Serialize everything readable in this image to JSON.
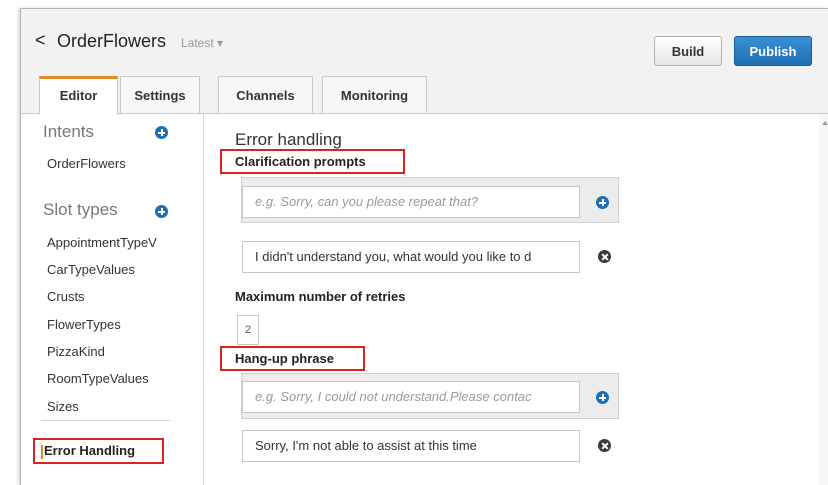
{
  "header": {
    "back_glyph": "<",
    "bot_name": "OrderFlowers",
    "version_label": "Latest ▾",
    "build_label": "Build",
    "publish_label": "Publish"
  },
  "tabs": [
    {
      "label": "Editor",
      "active": true
    },
    {
      "label": "Settings",
      "active": false
    },
    {
      "label": "Channels",
      "active": false
    },
    {
      "label": "Monitoring",
      "active": false
    }
  ],
  "sidebar": {
    "intents_title": "Intents",
    "intents": [
      "OrderFlowers"
    ],
    "slot_types_title": "Slot types",
    "slot_types": [
      "AppointmentTypeV",
      "CarTypeValues",
      "Crusts",
      "FlowerTypes",
      "PizzaKind",
      "RoomTypeValues",
      "Sizes"
    ],
    "error_handling_label": "Error Handling"
  },
  "main": {
    "title": "Error handling",
    "clarification_label": "Clarification prompts",
    "clarification_placeholder": "e.g. Sorry, can you please repeat that?",
    "clarification_value": "I didn't understand you, what would you like to d",
    "retries_label": "Maximum number of retries",
    "retries_value": "2",
    "hangup_label": "Hang-up phrase",
    "hangup_placeholder": "e.g. Sorry, I could not understand.Please contac",
    "hangup_value": "Sorry, I'm not able to assist at this time"
  },
  "icons": {
    "add": "plus-circle-icon",
    "delete": "x-circle-icon",
    "back": "chevron-left-icon"
  },
  "colors": {
    "primary": "#1f6fb2",
    "active_tab_accent": "#e58a1f",
    "highlight_box": "#e02020"
  }
}
